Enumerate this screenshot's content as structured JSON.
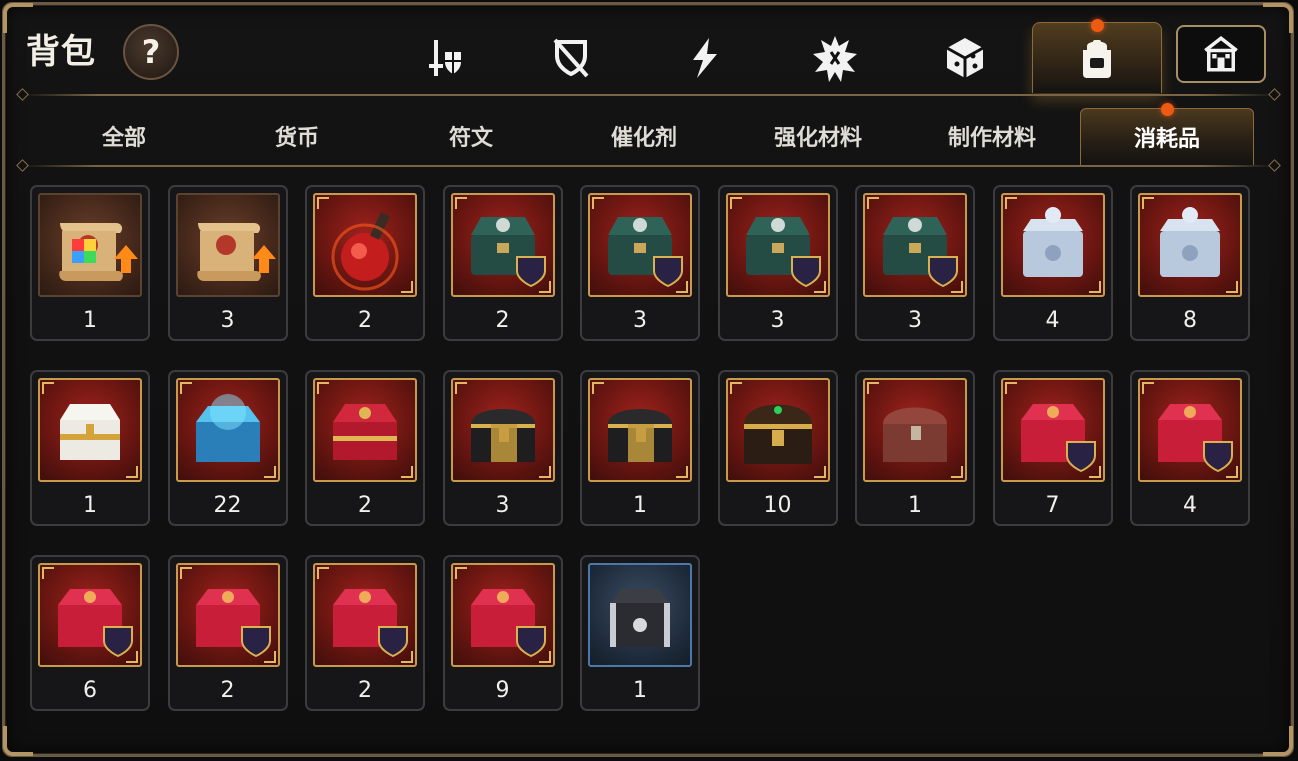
{
  "header": {
    "title": "背包",
    "help_label": "?",
    "top_tabs": [
      {
        "icon": "sword-shield-icon",
        "active": false
      },
      {
        "icon": "broken-shield-icon",
        "active": false
      },
      {
        "icon": "lightning-icon",
        "active": false
      },
      {
        "icon": "burst-rune-icon",
        "active": false
      },
      {
        "icon": "cube-icon",
        "active": false
      },
      {
        "icon": "backpack-icon",
        "active": true
      }
    ],
    "house_button_icon": "house-icon"
  },
  "sub_tabs": [
    {
      "label": "全部",
      "active": false
    },
    {
      "label": "货币",
      "active": false
    },
    {
      "label": "符文",
      "active": false
    },
    {
      "label": "催化剂",
      "active": false
    },
    {
      "label": "强化材料",
      "active": false
    },
    {
      "label": "制作材料",
      "active": false
    },
    {
      "label": "消耗品",
      "active": true
    }
  ],
  "colors": {
    "accent_gold": "#c79b4b",
    "notification_dot": "#ef5a12",
    "frame_border": "#6a5a43"
  },
  "items": [
    {
      "icon": "scroll-gem-upgrade-icon",
      "frame": "brown",
      "count": "1"
    },
    {
      "icon": "scroll-upgrade-icon",
      "frame": "brown",
      "count": "3"
    },
    {
      "icon": "red-potion-icon",
      "frame": "red",
      "count": "2"
    },
    {
      "icon": "green-chest-arrow-icon",
      "frame": "red",
      "count": "2"
    },
    {
      "icon": "green-chest-sword-icon",
      "frame": "red",
      "count": "3"
    },
    {
      "icon": "green-chest-drop-icon",
      "frame": "red",
      "count": "3"
    },
    {
      "icon": "green-chest-claw-icon",
      "frame": "red",
      "count": "3"
    },
    {
      "icon": "silver-box-icon",
      "frame": "red",
      "count": "4"
    },
    {
      "icon": "silver-box-icon",
      "frame": "red",
      "count": "8"
    },
    {
      "icon": "white-gold-chest-icon",
      "frame": "red",
      "count": "1"
    },
    {
      "icon": "blue-crystal-chest-icon",
      "frame": "red",
      "count": "22"
    },
    {
      "icon": "red-gold-chest-icon",
      "frame": "red",
      "count": "2"
    },
    {
      "icon": "black-gold-chest-icon",
      "frame": "red",
      "count": "3"
    },
    {
      "icon": "black-gold-chest-icon",
      "frame": "red",
      "count": "1"
    },
    {
      "icon": "ornate-treasure-chest-icon",
      "frame": "red",
      "count": "10"
    },
    {
      "icon": "wooden-red-chest-icon",
      "frame": "red",
      "count": "1"
    },
    {
      "icon": "red-box-sword-icon",
      "frame": "red",
      "count": "7"
    },
    {
      "icon": "red-box-heart-icon",
      "frame": "red",
      "count": "4"
    },
    {
      "icon": "red-box-burst-icon",
      "frame": "red",
      "count": "6"
    },
    {
      "icon": "red-box-hand-icon",
      "frame": "red",
      "count": "2"
    },
    {
      "icon": "red-box-broken-sword-icon",
      "frame": "red",
      "count": "2"
    },
    {
      "icon": "red-box-flame-icon",
      "frame": "red",
      "count": "9"
    },
    {
      "icon": "iron-box-icon",
      "frame": "blue",
      "count": "1"
    }
  ]
}
